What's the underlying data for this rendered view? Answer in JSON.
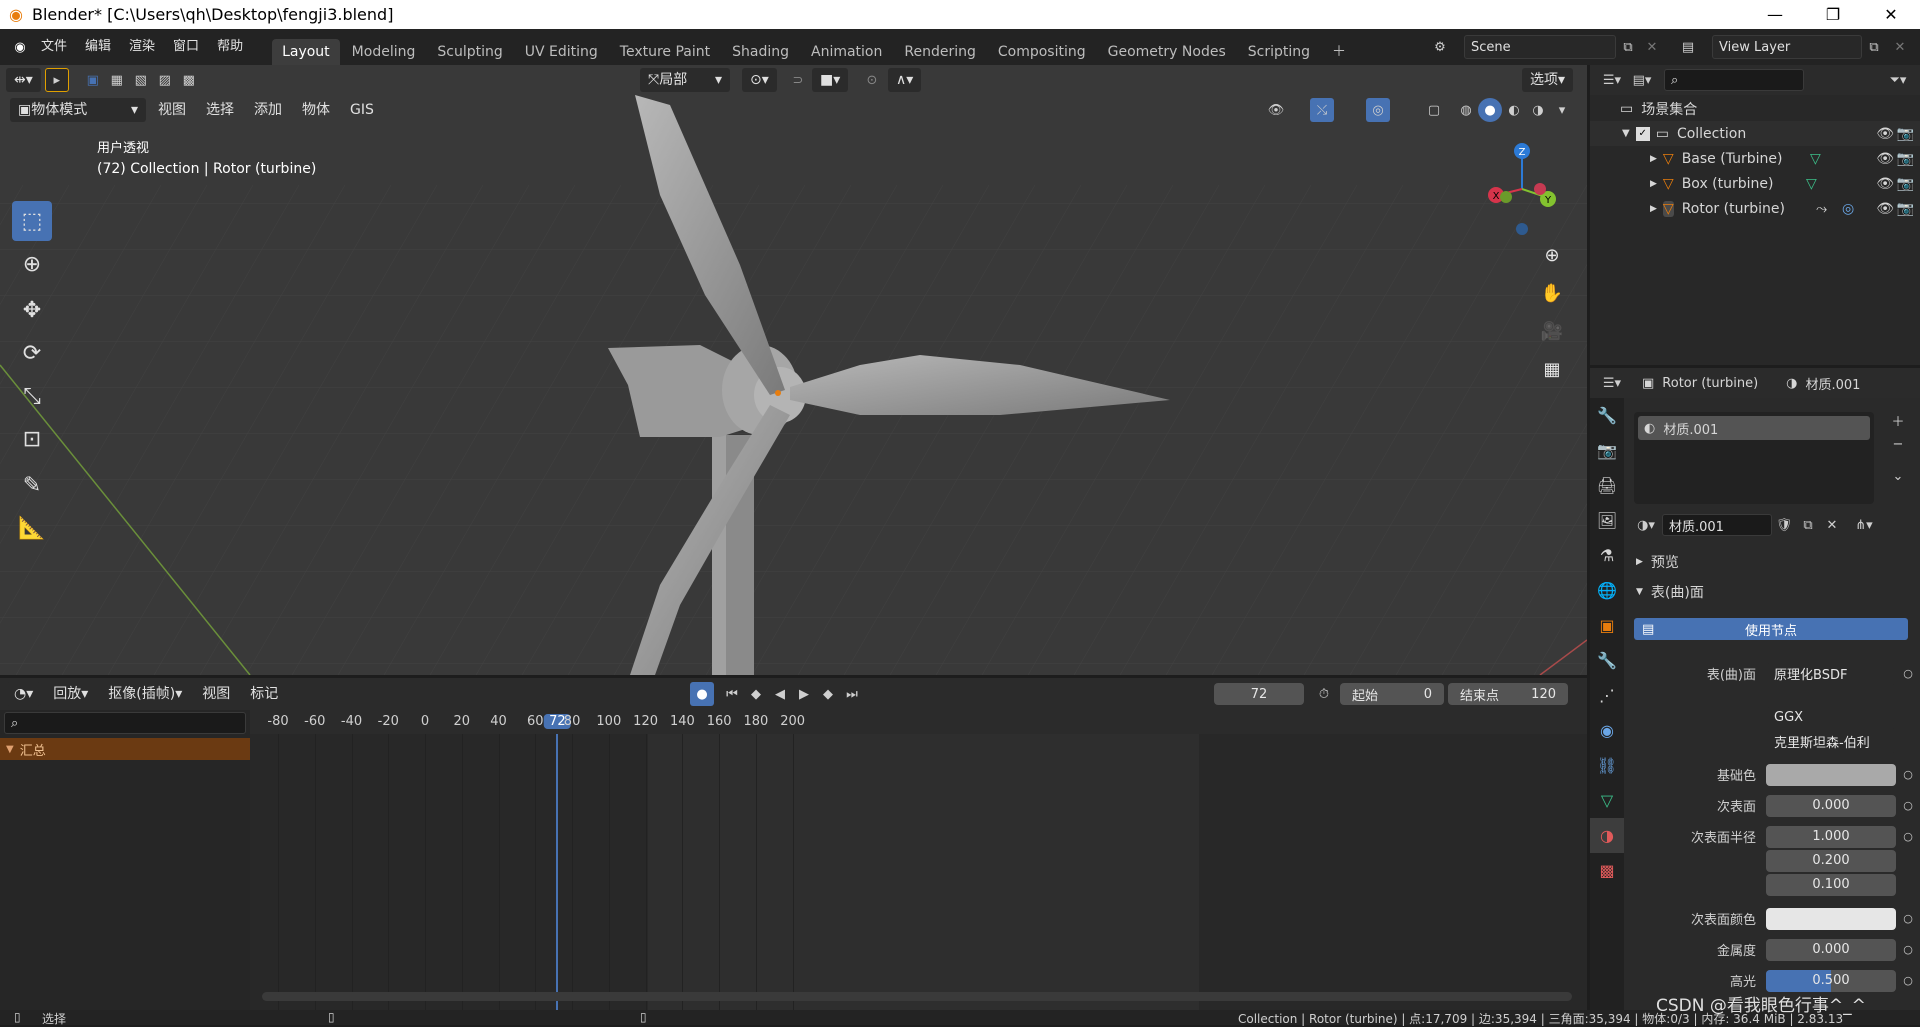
{
  "window": {
    "title": "Blender* [C:\\Users\\qh\\Desktop\\fengji3.blend]",
    "minimize": "—",
    "maximize": "❐",
    "close": "✕"
  },
  "menu": [
    "文件",
    "编辑",
    "渲染",
    "窗口",
    "帮助"
  ],
  "workspaces": [
    "Layout",
    "Modeling",
    "Sculpting",
    "UV Editing",
    "Texture Paint",
    "Shading",
    "Animation",
    "Rendering",
    "Compositing",
    "Geometry Nodes",
    "Scripting"
  ],
  "active_workspace": "Layout",
  "scene": {
    "name": "Scene",
    "view_layer": "View Layer"
  },
  "viewport": {
    "transform_orientation": "局部",
    "options_label": "选项",
    "mode": "物体模式",
    "menus": [
      "视图",
      "选择",
      "添加",
      "物体",
      "GIS"
    ],
    "overlay_title": "用户透视",
    "overlay_subtitle": "(72) Collection | Rotor (turbine)",
    "gizmo": {
      "x": "X",
      "y": "Y",
      "z": "Z"
    }
  },
  "outliner": {
    "root": "场景集合",
    "collection": "Collection",
    "objects": [
      "Base (Turbine)",
      "Box (turbine)",
      "Rotor (turbine)"
    ]
  },
  "properties": {
    "object": "Rotor (turbine)",
    "material": "材质.001",
    "slot_name": "材质.001",
    "material_field": "材质.001",
    "panel_preview": "预览",
    "panel_surface": "表(曲)面",
    "use_nodes": "使用节点",
    "rows": [
      {
        "label": "表(曲)面",
        "value": "原理化BSDF"
      },
      {
        "label": "",
        "value": "GGX"
      },
      {
        "label": "",
        "value": "克里斯坦森-伯利"
      },
      {
        "label": "基础色",
        "value": ""
      },
      {
        "label": "次表面",
        "value": "0.000"
      },
      {
        "label": "次表面半径",
        "value": "1.000"
      },
      {
        "label": "",
        "value": "0.200"
      },
      {
        "label": "",
        "value": "0.100"
      },
      {
        "label": "次表面颜色",
        "value": ""
      },
      {
        "label": "金属度",
        "value": "0.000"
      },
      {
        "label": "高光",
        "value": "0.500"
      }
    ],
    "specular_fill": 0.5
  },
  "timeline": {
    "menus": [
      "回放",
      "抠像(插帧)",
      "视图",
      "标记"
    ],
    "current_frame": "72",
    "start_label": "起始",
    "start": "0",
    "end_label": "结束点",
    "end": "120",
    "summary": "汇总",
    "ticks": [
      "-80",
      "-60",
      "-40",
      "-20",
      "0",
      "20",
      "40",
      "60",
      "72",
      "80",
      "100",
      "120",
      "140",
      "160",
      "180",
      "200"
    ]
  },
  "status": {
    "left": "选择",
    "right": "Collection | Rotor (turbine) | 点:17,709 | 边:35,394 | 三角面:35,394 | 物体:0/3 | 内存: 36.4 MiB | 2.83.13",
    "watermark": "CSDN @看我眼色行事^_^"
  },
  "colors": {
    "accent": "#4772b3",
    "orange": "#e87d0d",
    "grid": "#3c3c3c"
  }
}
